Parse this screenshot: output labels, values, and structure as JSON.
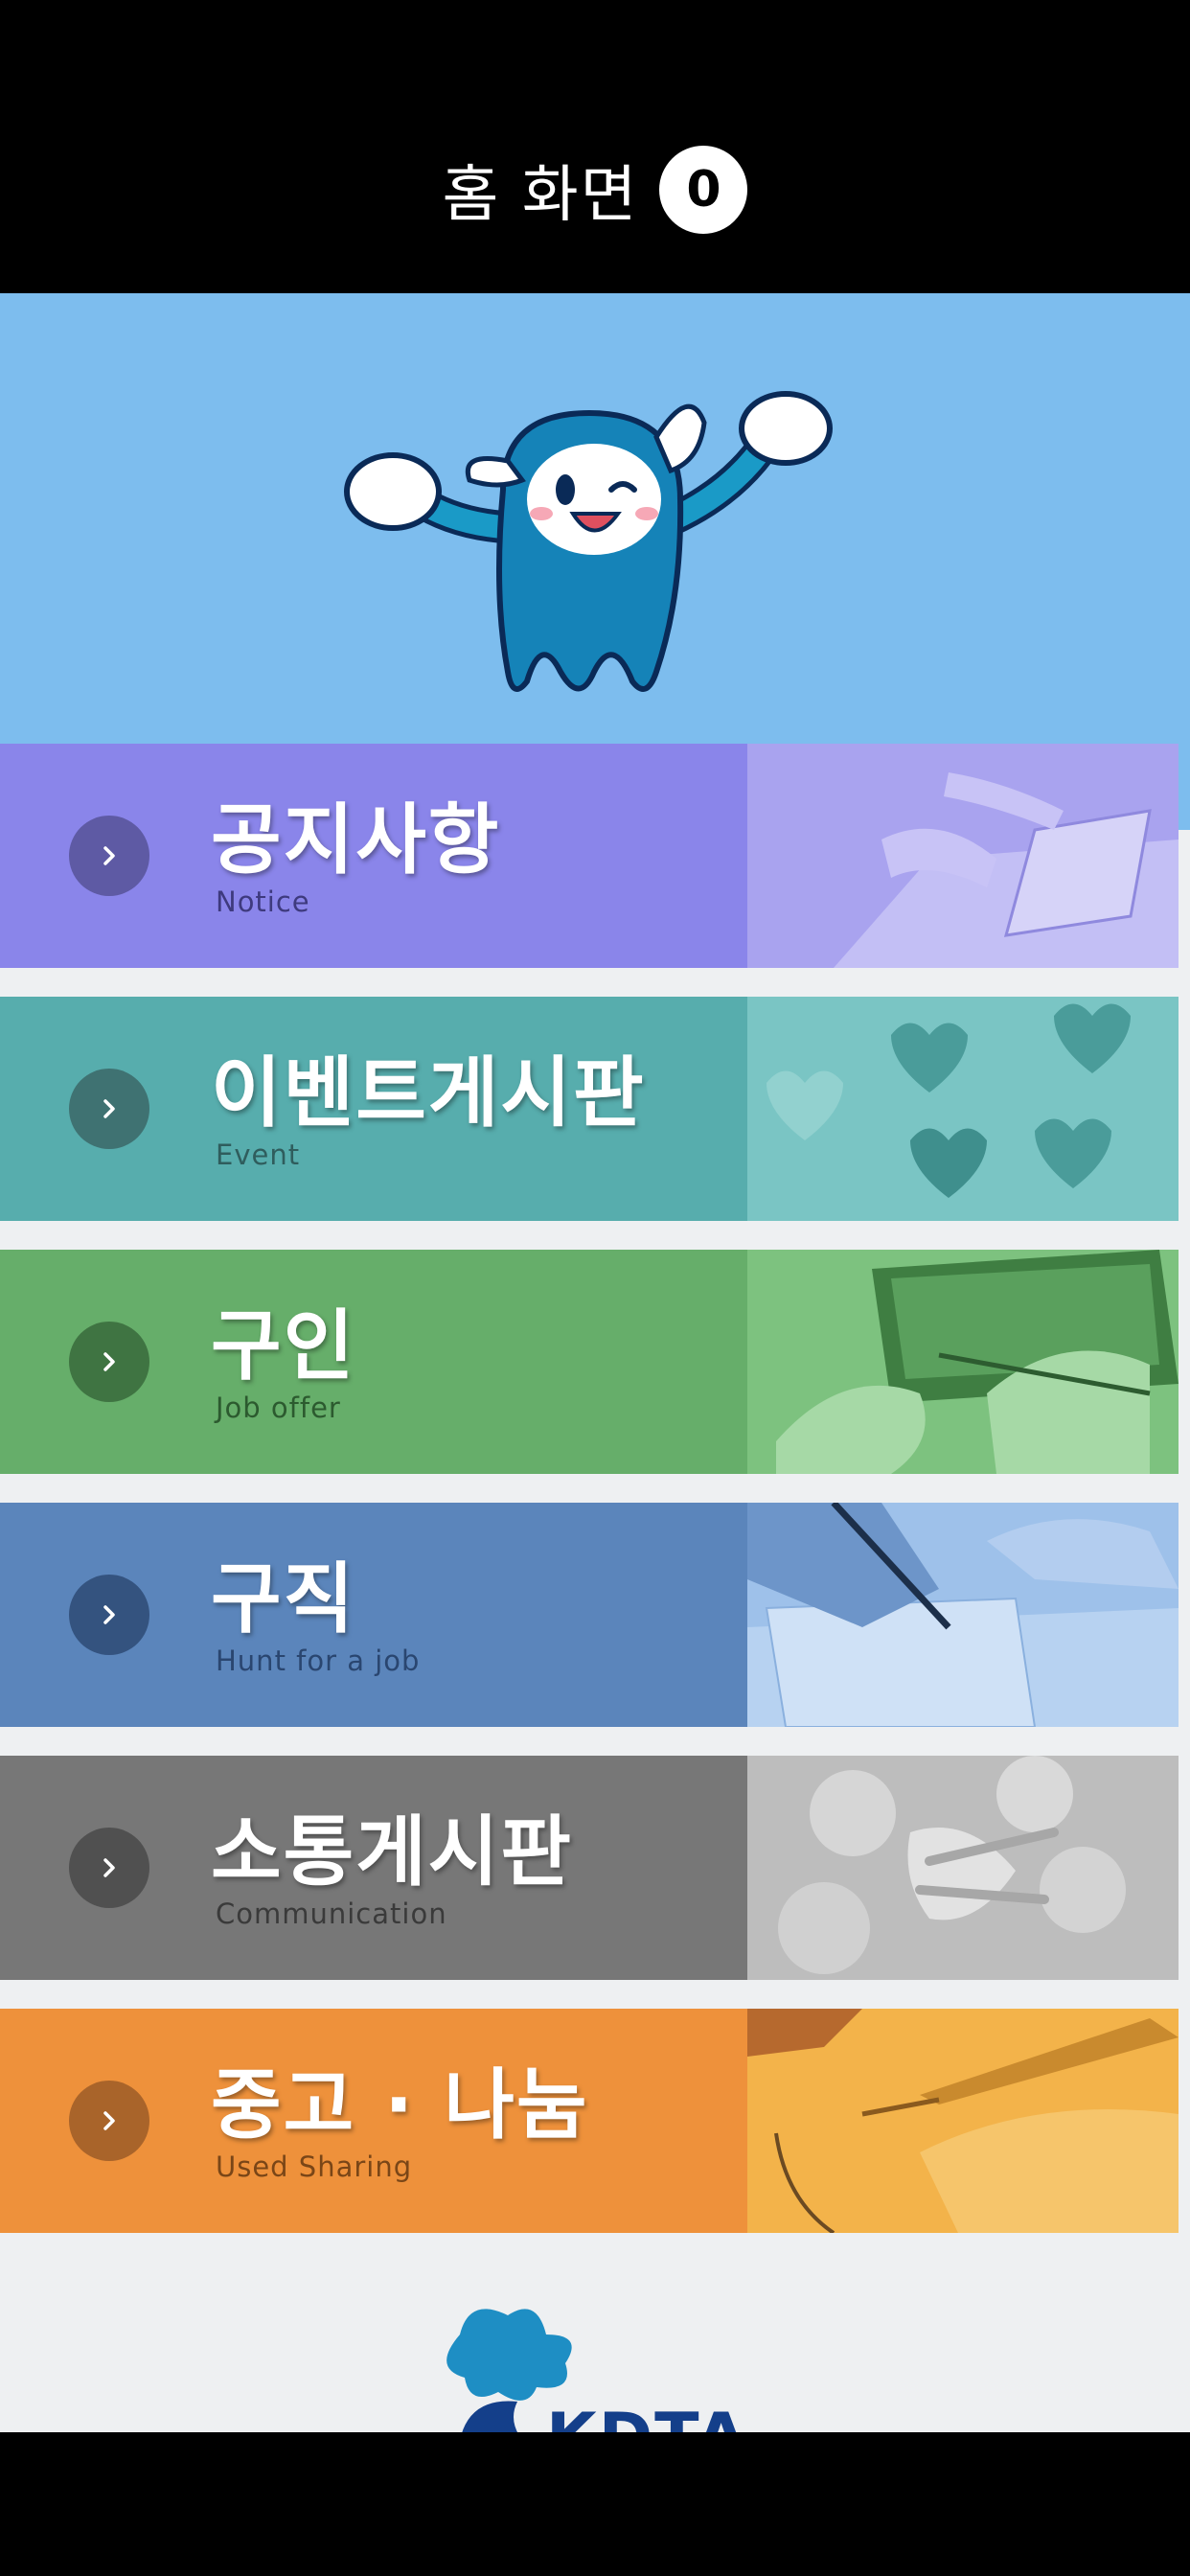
{
  "header": {
    "title": "홈 화면",
    "badge_count": "0"
  },
  "menu": [
    {
      "title": "공지사항",
      "subtitle": "Notice",
      "color": "#8a85ea",
      "photo_tint": "#a9a3ef"
    },
    {
      "title": "이벤트게시판",
      "subtitle": "Event",
      "color": "#57adad",
      "photo_tint": "#7ac5c4"
    },
    {
      "title": "구인",
      "subtitle": "Job offer",
      "color": "#66ae6a",
      "photo_tint": "#7dc27f"
    },
    {
      "title": "구직",
      "subtitle": "Hunt for a job",
      "color": "#5b85bb",
      "photo_tint": "#9ec1ea"
    },
    {
      "title": "소통게시판",
      "subtitle": "Communication",
      "color": "#777777",
      "photo_tint": "#bdbdbd"
    },
    {
      "title": "중고 · 나눔",
      "subtitle": "Used Sharing",
      "color": "#ee913b",
      "photo_tint": "#f3b34a"
    }
  ],
  "footer": {
    "logo_text": "KDTA"
  },
  "colors": {
    "hero_bg": "#7dbdee",
    "page_bg": "#eef0f2",
    "logo_blue": "#1e8ec4"
  }
}
